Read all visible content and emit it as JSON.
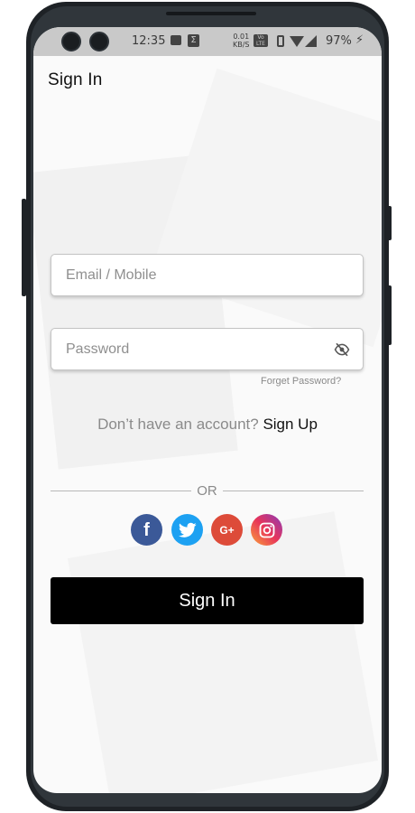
{
  "status_bar": {
    "time": "12:35",
    "network_speed_line1": "0.01",
    "network_speed_line2": "KB/S",
    "volte_line1": "Vo",
    "volte_line2": "LTE",
    "battery": "97%",
    "icons": [
      "image-icon",
      "sigma-icon",
      "volte-icon",
      "vibrate-icon",
      "wifi-icon",
      "signal-icon",
      "charging-icon"
    ]
  },
  "header": {
    "title": "Sign In"
  },
  "form": {
    "email_placeholder": "Email / Mobile",
    "password_placeholder": "Password",
    "forgot_label": "Forget Password?"
  },
  "signup": {
    "prompt": "Don’t have an account?",
    "link": "Sign Up"
  },
  "divider": {
    "label": "OR"
  },
  "social": [
    {
      "name": "facebook",
      "color": "#3b5998"
    },
    {
      "name": "twitter",
      "color": "#1da1f2"
    },
    {
      "name": "google-plus",
      "color": "#dd4b39",
      "label": "G+"
    },
    {
      "name": "instagram",
      "color": "#e8355a"
    }
  ],
  "actions": {
    "signin_label": "Sign In"
  },
  "colors": {
    "primary_button": "#000000",
    "background": "#fafafa"
  }
}
